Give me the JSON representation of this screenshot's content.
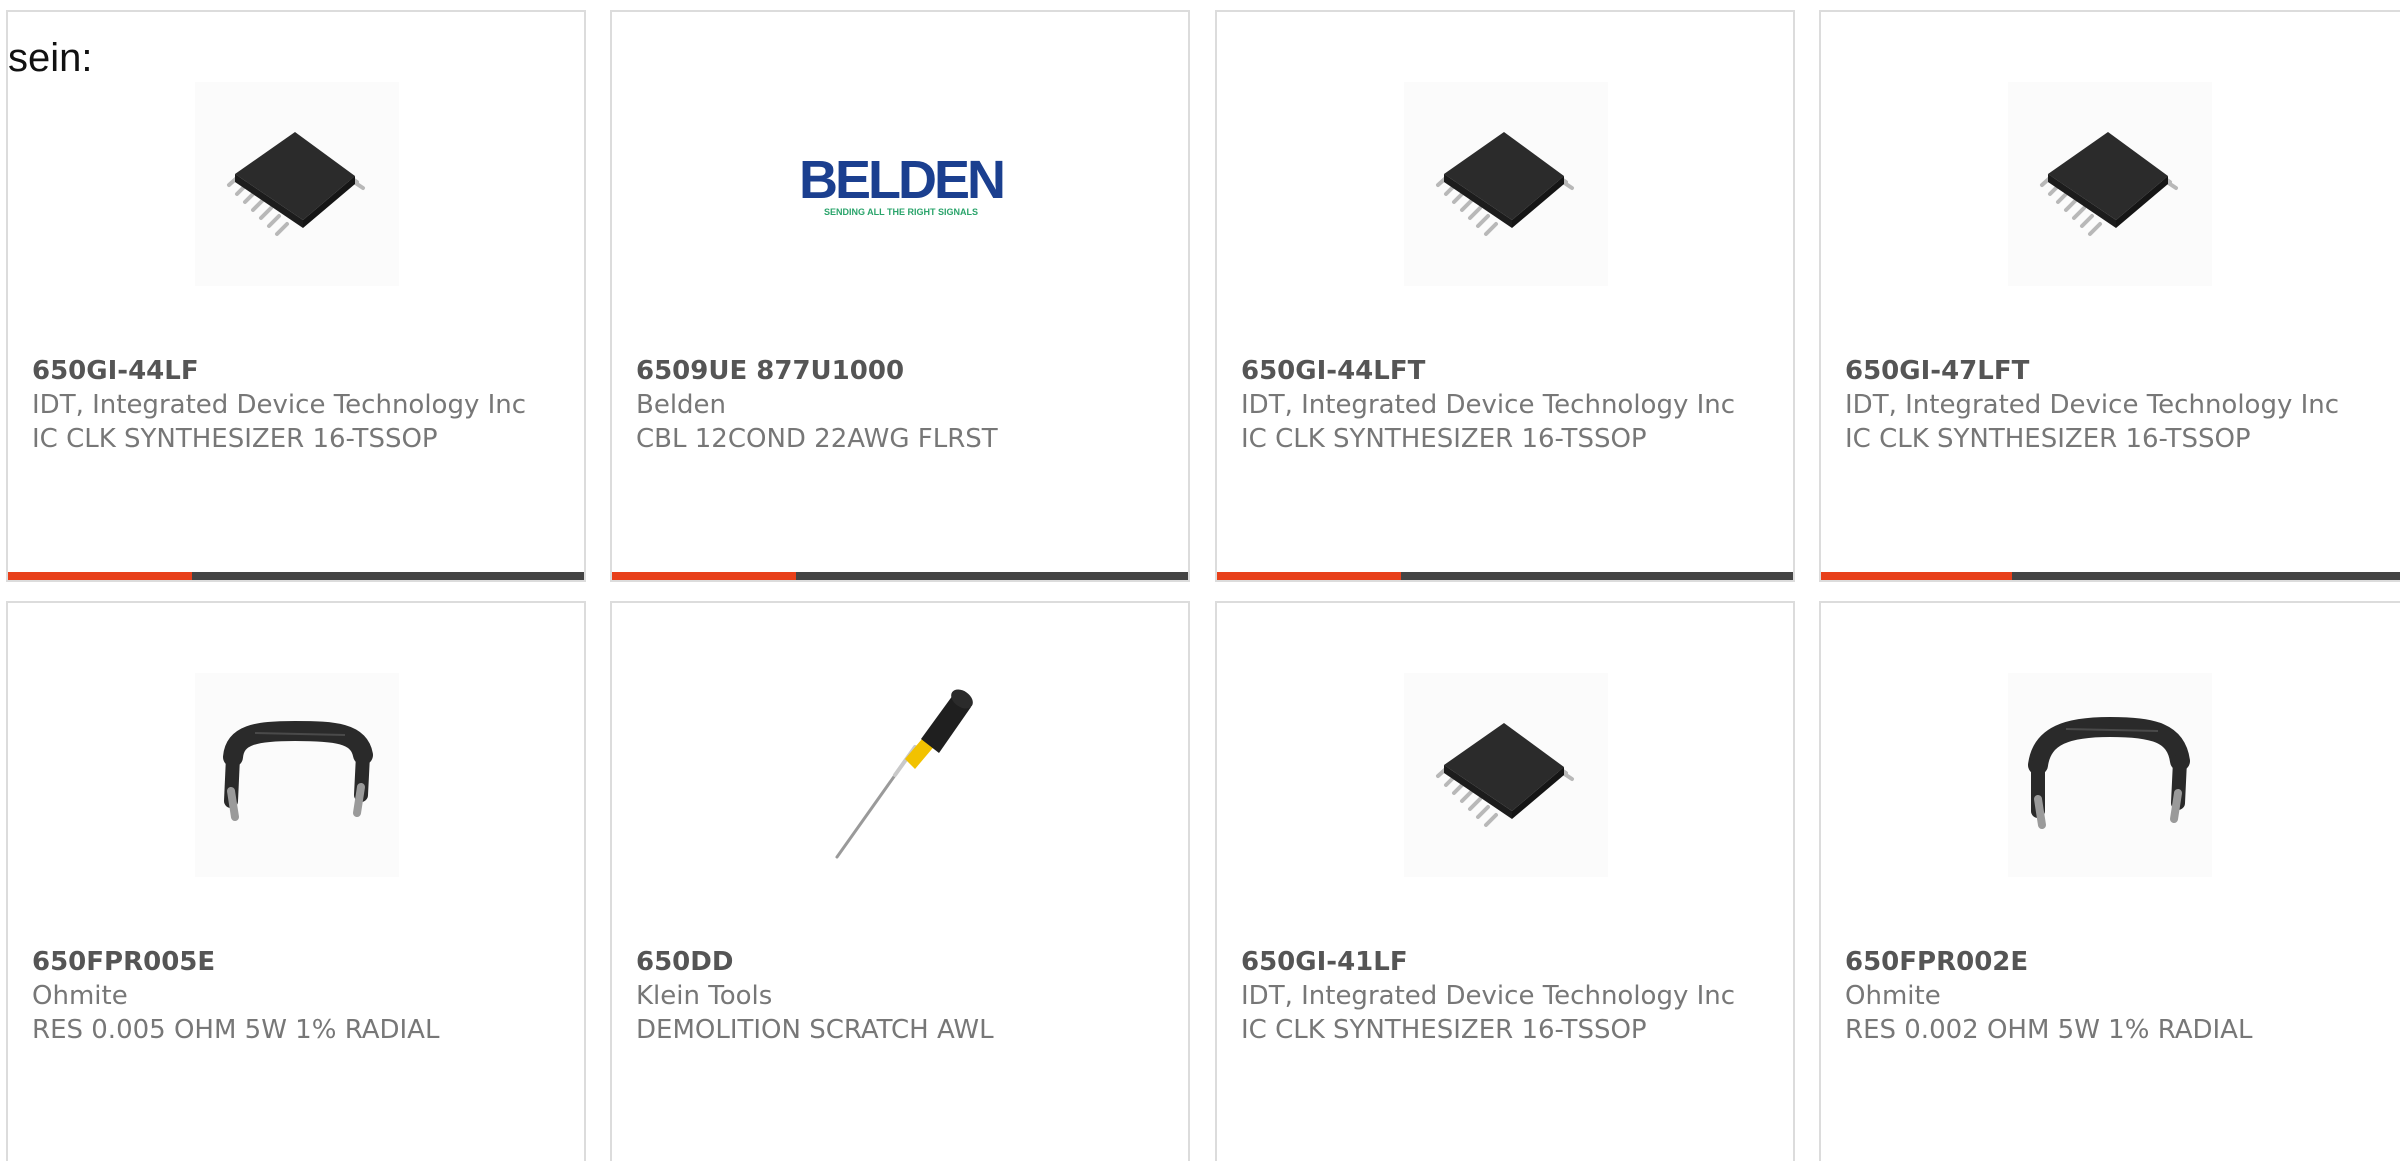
{
  "lead_text": "sein:",
  "colors": {
    "accent": "#e8401a",
    "bar_track": "#444444",
    "card_border": "#dcdcdc",
    "text_muted": "#777777",
    "text_strong": "#555555"
  },
  "cards": [
    {
      "part_number": "650GI-44LF",
      "manufacturer": "IDT, Integrated Device Technology Inc",
      "description": "IC CLK SYNTHESIZER 16-TSSOP",
      "image": "tssop-chip-image",
      "progress_fraction": 0.32
    },
    {
      "part_number": "6509UE 877U1000",
      "manufacturer": "Belden",
      "description": "CBL 12COND 22AWG FLRST",
      "image": "belden-logo",
      "logo_text": "BELDEN",
      "logo_tagline": "SENDING ALL THE RIGHT SIGNALS",
      "progress_fraction": 0.32
    },
    {
      "part_number": "650GI-44LFT",
      "manufacturer": "IDT, Integrated Device Technology Inc",
      "description": "IC CLK SYNTHESIZER 16-TSSOP",
      "image": "tssop-chip-image",
      "progress_fraction": 0.32
    },
    {
      "part_number": "650GI-47LFT",
      "manufacturer": "IDT, Integrated Device Technology Inc",
      "description": "IC CLK SYNTHESIZER 16-TSSOP",
      "image": "tssop-chip-image",
      "progress_fraction": 0.32
    },
    {
      "part_number": "650FPR005E",
      "manufacturer": "Ohmite",
      "description": "RES 0.005 OHM 5W 1% RADIAL",
      "image": "radial-resistor-image"
    },
    {
      "part_number": "650DD",
      "manufacturer": "Klein Tools",
      "description": "DEMOLITION SCRATCH AWL",
      "image": "scratch-awl-image"
    },
    {
      "part_number": "650GI-41LF",
      "manufacturer": "IDT, Integrated Device Technology Inc",
      "description": "IC CLK SYNTHESIZER 16-TSSOP",
      "image": "tssop-chip-image"
    },
    {
      "part_number": "650FPR002E",
      "manufacturer": "Ohmite",
      "description": "RES 0.002 OHM 5W 1% RADIAL",
      "image": "radial-resistor-image"
    }
  ]
}
